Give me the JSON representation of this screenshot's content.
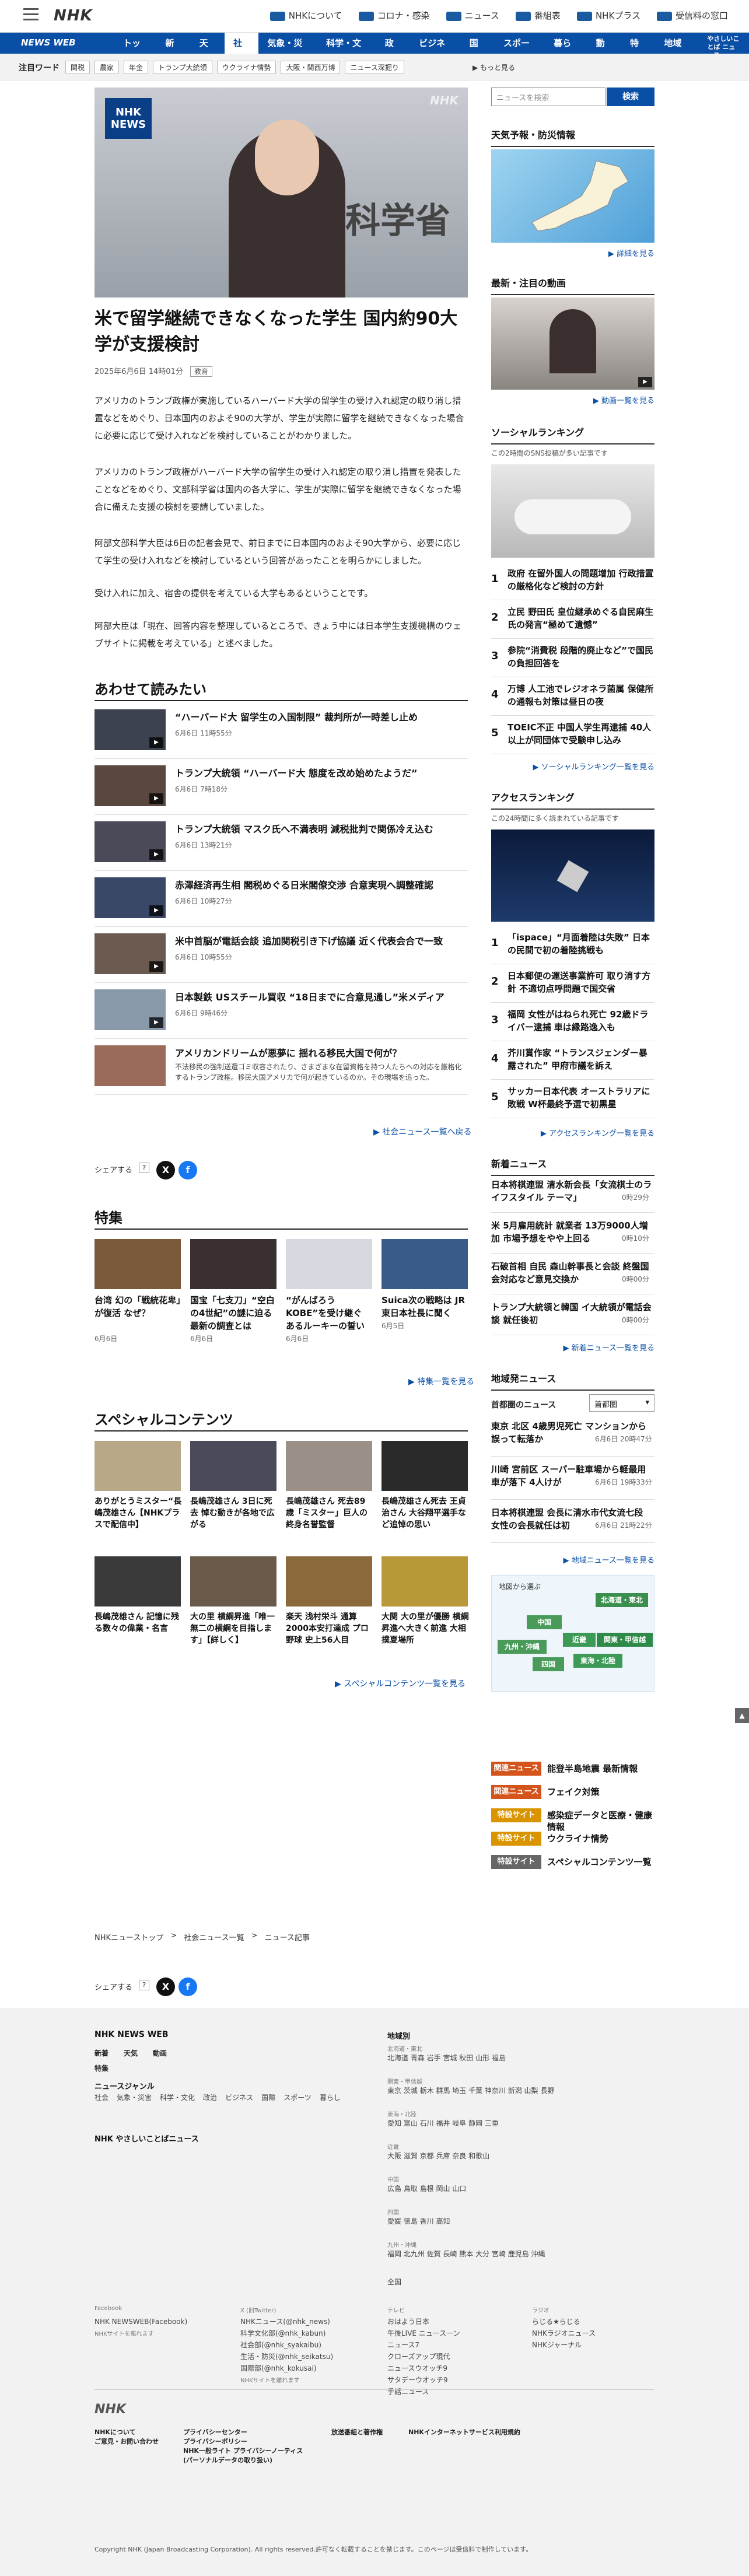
{
  "header": {
    "logo": "NHK",
    "links": [
      "NHKについて",
      "コロナ・感染",
      "ニュース",
      "番組表",
      "NHKプラス",
      "受信料の窓口"
    ]
  },
  "nav": {
    "brand": "NEWS WEB",
    "items": [
      "トップ",
      "新着",
      "天気",
      "社会",
      "気象・災害",
      "科学・文化",
      "政治",
      "ビジネス",
      "国際",
      "スポーツ",
      "暮らし",
      "動画",
      "特集",
      "地域 ▼",
      "やさしいことば ニュース"
    ],
    "active_index": 3
  },
  "trend": {
    "label": "注目ワード",
    "tags": [
      "関税",
      "農家",
      "年金",
      "トランプ大統領",
      "ウクライナ情勢",
      "大阪・関西万博",
      "ニュース深掘り"
    ],
    "more": "▶ もっと見る"
  },
  "article": {
    "hero_badge": "NHK NEWS",
    "hero_sign": "科学省",
    "hero_overlay": "NHK",
    "title": "米で留学継続できなくなった学生 国内約90大学が支援検討",
    "date": "2025年6月6日 14時01分",
    "category": "教育",
    "paragraphs": [
      "アメリカのトランプ政権が実施しているハーバード大学の留学生の受け入れ認定の取り消し措置などをめぐり、日本国内のおよそ90の大学が、学生が実際に留学を継続できなくなった場合に必要に応じて受け入れなどを検討していることがわかりました。",
      "アメリカのトランプ政権がハーバード大学の留学生の受け入れ認定の取り消し措置を発表したことなどをめぐり、文部科学省は国内の各大学に、学生が実際に留学を継続できなくなった場合に備えた支援の検討を要請していました。",
      "阿部文部科学大臣は6日の記者会見で、前日までに日本国内のおよそ90大学から、必要に応じて学生の受け入れなどを検討しているという回答があったことを明らかにしました。",
      "受け入れに加え、宿舎の提供を考えている大学もあるということです。",
      "阿部大臣は「現在、回答内容を整理しているところで、きょう中には日本学生支援機構のウェブサイトに掲載を考えている」と述べました。"
    ]
  },
  "related": {
    "heading": "あわせて読みたい",
    "items": [
      {
        "title": "“ハーバード大 留学生の入国制限” 裁判所が一時差し止め",
        "date": "6月6日 11時55分",
        "desc": ""
      },
      {
        "title": "トランプ大統領 “ハーバード大 態度を改め始めたようだ”",
        "date": "6月6日 7時18分",
        "desc": ""
      },
      {
        "title": "トランプ大統領 マスク氏へ不満表明 減税批判で関係冷え込む",
        "date": "6月6日 13時21分",
        "desc": ""
      },
      {
        "title": "赤澤経済再生相 閣税めぐる日米閣僚交渉 合意実現へ調整確認",
        "date": "6月6日 10時27分",
        "desc": ""
      },
      {
        "title": "米中首脳が電話会談 追加関税引き下げ協議 近く代表会合で一致",
        "date": "6月6日 10時55分",
        "desc": ""
      },
      {
        "title": "日本製鉄 USスチール買収 “18日までに合意見通し”米メディア",
        "date": "6月6日 9時46分",
        "desc": ""
      },
      {
        "title": "アメリカンドリームが悪夢に 揺れる移民大国で何が？",
        "date": "",
        "desc": "不法移民の強制送還ゴミ収容されたり、さまざまな在留資格を持つ人たちへの対応を厳格化するトランプ政権。移民大国アメリカで何が起きているのか。その現場を追った。"
      }
    ],
    "more": "▶ 社会ニュース一覧へ戻る"
  },
  "share": {
    "label": "シェアする",
    "icons": [
      "X",
      "f"
    ]
  },
  "features": {
    "heading": "特集",
    "items": [
      {
        "title": "台湾 幻の「戦統花卑」が復活 なぜ？",
        "date": "6月6日"
      },
      {
        "title": "国宝「七支刀」“空白の4世紀”の謎に迫る最新の調査とは",
        "date": "6月6日"
      },
      {
        "title": "“がんばろうKOBE”を受け継ぐ あるルーキーの誓い",
        "date": "6月6日"
      },
      {
        "title": "Suica次の戦略は JR東日本社長に聞く",
        "date": "6月5日"
      }
    ],
    "more": "▶ 特集一覧を見る"
  },
  "special": {
    "heading": "スペシャルコンテンツ",
    "items": [
      "ありがとうミスター“長嶋茂雄さん【NHKプラスで配信中】",
      "長嶋茂雄さん 3日に死去 悼む動きが各地で広がる",
      "長嶋茂雄さん 死去89歳「ミスター」巨人の終身名誉監督",
      "長嶋茂雄さん死去 王貞治さん 大谷翔平選手など追悼の思い",
      "長嶋茂雄さん 記憶に残る数々の偉業・名言",
      "大の里 横綱昇進「唯一無二の横綱を目指します」【詳しく】",
      "楽天 浅村栄斗 通算2000本安打達成 プロ野球 史上56人目",
      "大関 大の里が優勝 横綱昇進へ大きく前進 大相撲夏場所"
    ],
    "more": "▶ スペシャルコンテンツ一覧を見る"
  },
  "breadcrumb": [
    "NHKニューストップ",
    "社会ニュース一覧",
    "ニュース記事"
  ],
  "sidebar": {
    "search_placeholder": "ニュースを検索",
    "search_button": "検索",
    "weather_heading": "天気予報・防災情報",
    "weather_more": "▶ 詳細を見る",
    "video_heading": "最新・注目の動画",
    "video_more": "▶ 動画一覧を見る",
    "social_heading": "ソーシャルランキング",
    "social_sub": "この2時間のSNS投稿が多い記事です",
    "social_items": [
      "政府 在留外国人の問題增加 行政措置の厳格化など検討の方針",
      "立民 野田氏 皇位継承めぐる自民麻生氏の発言“極めて遺憾”",
      "参院“消費税 段階的廃止など”で国民の負担回答を",
      "万博 人工池でレジオネラ菌属 保健所の通報も対策は昼日の夜",
      "TOEIC不正 中国人学生再逮捕 40人以上が同団体で受験申し込み"
    ],
    "social_more": "▶ ソーシャルランキング一覧を見る",
    "access_heading": "アクセスランキング",
    "access_sub": "この24時間に多く読まれている記事です",
    "access_items": [
      "「ispace」“月面着陸は失敗” 日本の民間で初の着陸挑戦も",
      "日本郵便の運送事業許可 取り消す方針 不適切点呼問題で国交省",
      "福岡 女性がはねられ死亡 92歳ドライバー逮捕 車は縁路逸入も",
      "芥川賞作家 “トランスジェンダー暴露された” 甲府市議を訴え",
      "サッカー日本代表 オーストラリアに敗戦 W杯最終予選で初黒星"
    ],
    "access_more": "▶ アクセスランキング一覧を見る",
    "new_heading": "新着ニュース",
    "new_items": [
      {
        "title": "日本将棋連盟 清水新会長「女流棋士のライフスタイル テーマ」",
        "date": "0時29分"
      },
      {
        "title": "米 5月雇用統計 就業者 13万9000人増加 市場予想をやや上回る",
        "date": "0時10分"
      },
      {
        "title": "石破首相 自民 森山幹事長と会談 終盤国会対応など意見交換か",
        "date": "0時00分"
      },
      {
        "title": "トランプ大統領と韓国 イ大統領が電話会談 就任後初",
        "date": "0時00分"
      }
    ],
    "new_more": "▶ 新着ニュース一覧を見る",
    "region_heading": "地域発ニュース",
    "region_label": "首都圏のニュース",
    "region_select": "首都圏",
    "region_items": [
      {
        "title": "東京 北区 4歳男児死亡 マンションから誤って転落か",
        "date": "6月6日 20時47分"
      },
      {
        "title": "川崎 宮前区 スーパー駐車場から軽最用車が落下 4人けが",
        "date": "6月6日 19時33分"
      },
      {
        "title": "日本将棋連盟 会長に清水市代女流七段 女性の会長就任は初",
        "date": "6月6日 21時22分"
      }
    ],
    "region_more": "▶ 地域ニュース一覧を見る",
    "map_label": "地図から選ぶ",
    "map_regions": [
      "北海道・東北",
      "中国",
      "近畿",
      "関東・甲信越",
      "九州・沖縄",
      "四国",
      "東海・北陸"
    ],
    "pills": [
      {
        "tag": "関連ニュース",
        "text": "能登半島地震 最新情報",
        "color": "#d4541c"
      },
      {
        "tag": "関連ニュース",
        "text": "フェイク対策",
        "color": "#d4541c"
      },
      {
        "tag": "特設サイト",
        "text": "感染症データと医療・健康情報",
        "color": "#d99400"
      },
      {
        "tag": "特設サイト",
        "text": "ウクライナ情勢",
        "color": "#d99400"
      },
      {
        "tag": "特設サイト",
        "text": "スペシャルコンテンツ一覧",
        "color": "#666666"
      }
    ]
  },
  "footer": {
    "brand": "NHK NEWS WEB",
    "top_links": [
      "新着",
      "天気",
      "動画"
    ],
    "tokushu": "特集",
    "genre_head": "ニュースジャンル",
    "genres": [
      "社会",
      "気象・災害",
      "科学・文化",
      "政治",
      "ビジネス",
      "国際",
      "スポーツ",
      "暮らし"
    ],
    "easy": "NHK やさしいことばニュース",
    "region_head": "地域別",
    "regions": [
      {
        "head": "北海道・東北",
        "items": "北海道 青森 岩手 宮城 秋田 山形 福島"
      },
      {
        "head": "関東・甲信越",
        "items": "東京 茨城 栃木 群馬 埼玉 千葉 神奈川 新潟 山梨 長野"
      },
      {
        "head": "東海・北陸",
        "items": "愛知 富山 石川 福井 岐阜 静岡 三重"
      },
      {
        "head": "近畿",
        "items": "大阪 滋賀 京都 兵庫 奈良 和歌山"
      },
      {
        "head": "中国",
        "items": "広島 鳥取 島根 岡山 山口"
      },
      {
        "head": "四国",
        "items": "愛媛 徳島 香川 高知"
      },
      {
        "head": "九州・沖縄",
        "items": "福岡 北九州 佐賀 長崎 熊本 大分 宮崎 鹿児島 沖縄"
      }
    ],
    "all_regions": "全国",
    "sns": [
      {
        "head": "Facebook",
        "items": [
          "NHK NEWSWEB(Facebook)"
        ],
        "note": "NHKサイトを離れます"
      },
      {
        "head": "X (旧Twitter)",
        "items": [
          "NHKニュース(@nhk_news)",
          "科学文化部(@nhk_kabun)",
          "社会部(@nhk_syakaibu)",
          "生活・防災(@nhk_seikatsu)",
          "国際部(@nhk_kokusai)"
        ],
        "note": "NHKサイトを離れます"
      },
      {
        "head": "テレビ",
        "items": [
          "おはよう日本",
          "午後LIVE ニュースーン",
          "ニュース7",
          "クローズアップ現代",
          "ニュースウオッチ9",
          "サタデーウオッチ9",
          "手話ニュース"
        ],
        "note": ""
      },
      {
        "head": "ラジオ",
        "items": [
          "らじる★らじる",
          "NHKラジオニュース",
          "NHKジャーナル"
        ],
        "note": ""
      }
    ],
    "logo": "NHK",
    "bottom_links": [
      [
        "NHKについて",
        "ご意見・お問い合わせ"
      ],
      [
        "プライバシーセンター",
        "プライバシーポリシー",
        "NHK一般ライト プライバシーノーティス",
        "(パーソナルデータの取り扱い)"
      ],
      [
        "放送番組と著作権"
      ],
      [
        "NHKインターネットサービス利用規約"
      ]
    ],
    "copyright": "Copyright NHK (Japan Broadcasting Corporation). All rights reserved.許可なく転載することを禁じます。このページは受信料で制作しています。"
  }
}
